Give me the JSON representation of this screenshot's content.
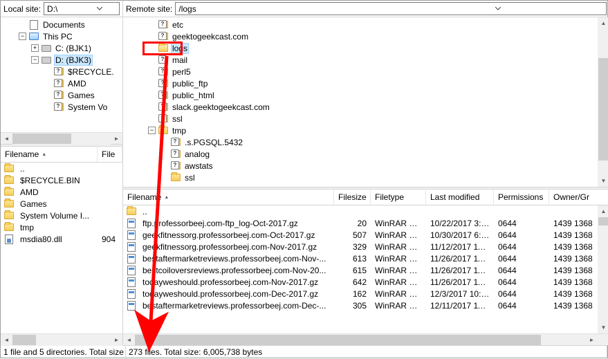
{
  "local": {
    "label": "Local site:",
    "path": "D:\\",
    "tree": [
      {
        "depth": 1,
        "exp": null,
        "icon": "doc",
        "label": "Documents"
      },
      {
        "depth": 1,
        "exp": "-",
        "icon": "pc",
        "label": "This PC"
      },
      {
        "depth": 2,
        "exp": "+",
        "icon": "drive",
        "label": "C: (BJK1)"
      },
      {
        "depth": 2,
        "exp": "-",
        "icon": "drive",
        "label": "D: (BJK3)",
        "selected": true
      },
      {
        "depth": 3,
        "exp": null,
        "icon": "folder-q",
        "label": "$RECYCLE."
      },
      {
        "depth": 3,
        "exp": null,
        "icon": "folder-q",
        "label": "AMD"
      },
      {
        "depth": 3,
        "exp": null,
        "icon": "folder-q",
        "label": "Games"
      },
      {
        "depth": 3,
        "exp": null,
        "icon": "folder-q",
        "label": "System Vo"
      }
    ],
    "file_cols": {
      "name": "Filename",
      "size": "File"
    },
    "files": [
      {
        "icon": "folder-y",
        "name": "..",
        "size": ""
      },
      {
        "icon": "folder-y",
        "name": "$RECYCLE.BIN",
        "size": ""
      },
      {
        "icon": "folder-y",
        "name": "AMD",
        "size": ""
      },
      {
        "icon": "folder-y",
        "name": "Games",
        "size": ""
      },
      {
        "icon": "folder-y",
        "name": "System Volume I...",
        "size": ""
      },
      {
        "icon": "folder-y",
        "name": "tmp",
        "size": ""
      },
      {
        "icon": "file-dll",
        "name": "msdia80.dll",
        "size": "904"
      }
    ],
    "status": "1 file and 5 directories. Total size"
  },
  "remote": {
    "label": "Remote site:",
    "path": "/logs",
    "tree": [
      {
        "depth": 1,
        "exp": null,
        "icon": "folder-q",
        "label": "etc"
      },
      {
        "depth": 1,
        "exp": null,
        "icon": "folder-q",
        "label": "geektogeekcast.com"
      },
      {
        "depth": 1,
        "exp": null,
        "icon": "folder-open",
        "label": "logs",
        "selected": true,
        "highlight": true
      },
      {
        "depth": 1,
        "exp": null,
        "icon": "folder-q",
        "label": "mail"
      },
      {
        "depth": 1,
        "exp": null,
        "icon": "folder-q",
        "label": "perl5"
      },
      {
        "depth": 1,
        "exp": null,
        "icon": "folder-q",
        "label": "public_ftp"
      },
      {
        "depth": 1,
        "exp": null,
        "icon": "folder-q",
        "label": "public_html"
      },
      {
        "depth": 1,
        "exp": null,
        "icon": "folder-q",
        "label": "slack.geektogeekcast.com"
      },
      {
        "depth": 1,
        "exp": null,
        "icon": "folder-q",
        "label": "ssl"
      },
      {
        "depth": 1,
        "exp": "-",
        "icon": "folder-y",
        "label": "tmp"
      },
      {
        "depth": 2,
        "exp": null,
        "icon": "folder-q",
        "label": ".s.PGSQL.5432"
      },
      {
        "depth": 2,
        "exp": null,
        "icon": "folder-q",
        "label": "analog"
      },
      {
        "depth": 2,
        "exp": null,
        "icon": "folder-q",
        "label": "awstats"
      },
      {
        "depth": 2,
        "exp": null,
        "icon": "folder-y",
        "label": "ssl"
      }
    ],
    "file_cols": {
      "name": "Filename",
      "size": "Filesize",
      "type": "Filetype",
      "modified": "Last modified",
      "perms": "Permissions",
      "owner": "Owner/Gr"
    },
    "files": [
      {
        "icon": "folder-y",
        "name": "..",
        "size": "",
        "type": "",
        "modified": "",
        "perms": "",
        "owner": ""
      },
      {
        "icon": "file-gz",
        "name": "ftp.professorbeej.com-ftp_log-Oct-2017.gz",
        "size": "20",
        "type": "WinRAR ar...",
        "modified": "10/22/2017 3:0...",
        "perms": "0644",
        "owner": "1439 1368"
      },
      {
        "icon": "file-gz",
        "name": "geekfitnessorg.professorbeej.com-Oct-2017.gz",
        "size": "507",
        "type": "WinRAR ar...",
        "modified": "10/30/2017 6:2...",
        "perms": "0644",
        "owner": "1439 1368"
      },
      {
        "icon": "file-gz",
        "name": "geekfitnessorg.professorbeej.com-Nov-2017.gz",
        "size": "329",
        "type": "WinRAR ar...",
        "modified": "11/12/2017 11:...",
        "perms": "0644",
        "owner": "1439 1368"
      },
      {
        "icon": "file-gz",
        "name": "bestaftermarketreviews.professorbeej.com-Nov-...",
        "size": "613",
        "type": "WinRAR ar...",
        "modified": "11/26/2017 11:...",
        "perms": "0644",
        "owner": "1439 1368"
      },
      {
        "icon": "file-gz",
        "name": "bestcoiloversreviews.professorbeej.com-Nov-20...",
        "size": "615",
        "type": "WinRAR ar...",
        "modified": "11/26/2017 11:...",
        "perms": "0644",
        "owner": "1439 1368"
      },
      {
        "icon": "file-gz",
        "name": "todayweshould.professorbeej.com-Nov-2017.gz",
        "size": "642",
        "type": "WinRAR ar...",
        "modified": "11/26/2017 11:...",
        "perms": "0644",
        "owner": "1439 1368"
      },
      {
        "icon": "file-gz",
        "name": "todayweshould.professorbeej.com-Dec-2017.gz",
        "size": "162",
        "type": "WinRAR ar...",
        "modified": "12/3/2017 10:5...",
        "perms": "0644",
        "owner": "1439 1368"
      },
      {
        "icon": "file-gz",
        "name": "bestaftermarketreviews.professorbeej.com-Dec-...",
        "size": "305",
        "type": "WinRAR ar...",
        "modified": "12/11/2017 11:...",
        "perms": "0644",
        "owner": "1439 1368"
      }
    ],
    "status": "273 files. Total size: 6,005,738 bytes"
  }
}
